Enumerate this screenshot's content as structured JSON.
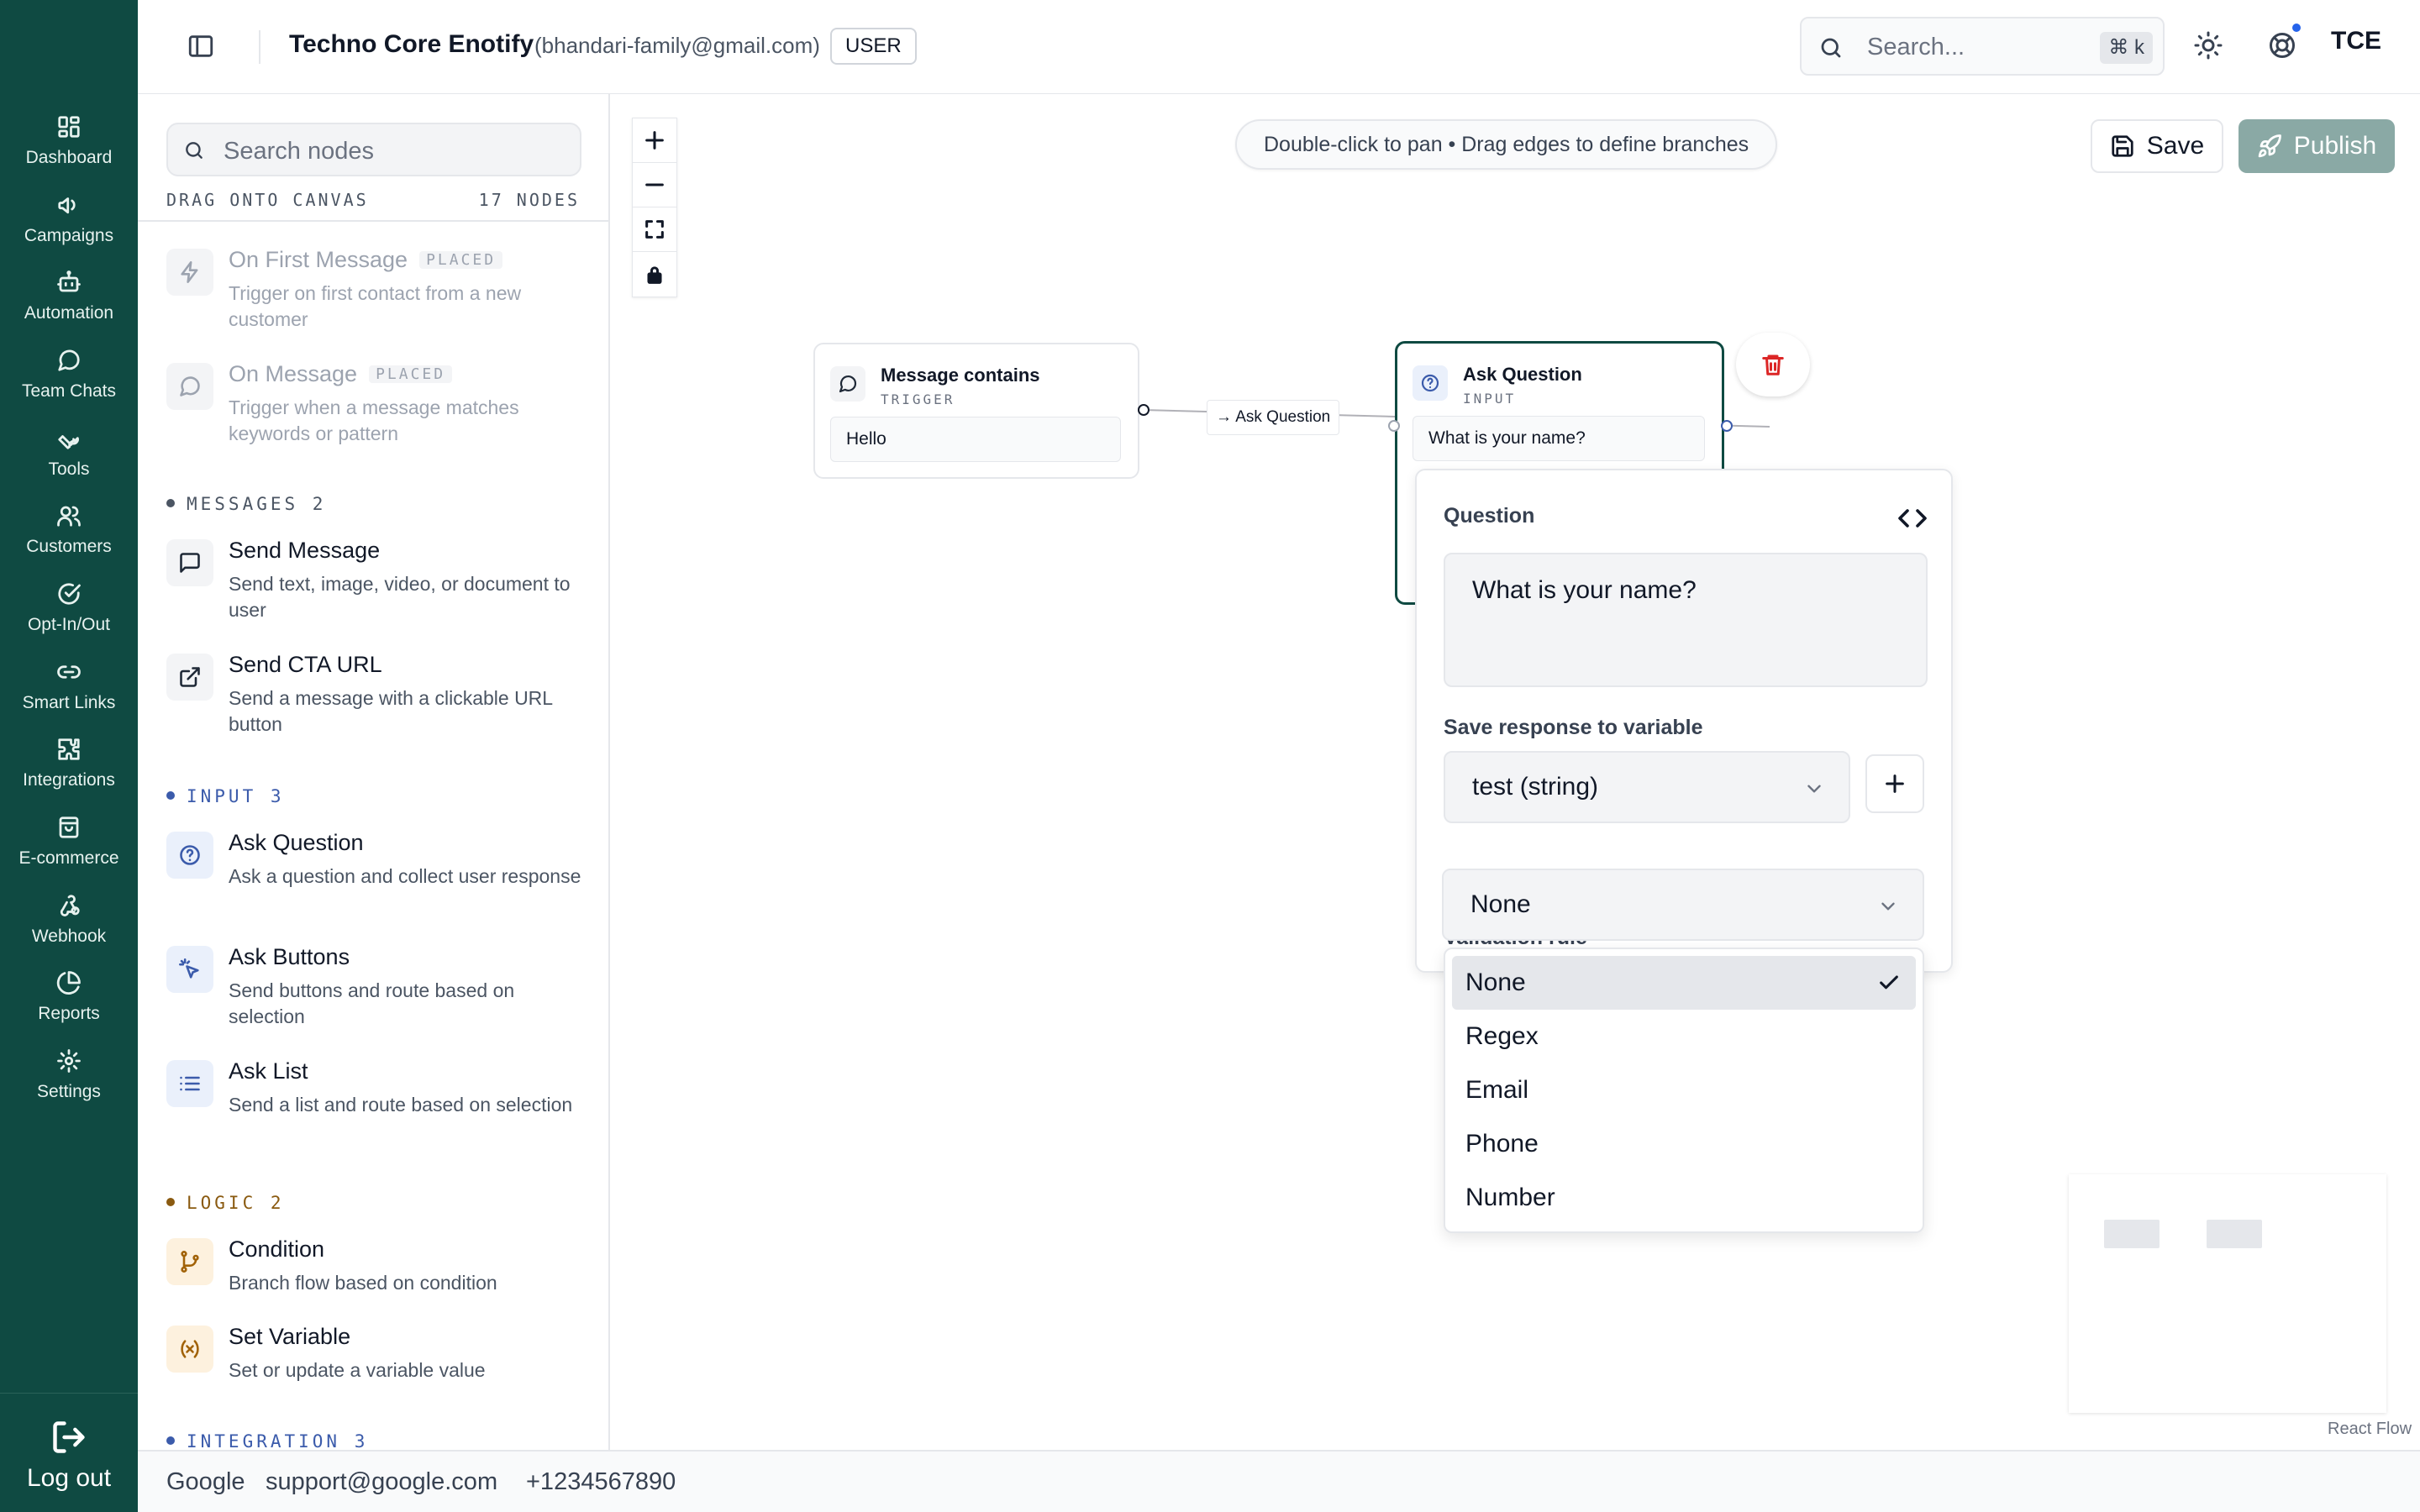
{
  "nav": {
    "items": [
      {
        "label": "Dashboard",
        "icon": "dashboard-icon"
      },
      {
        "label": "Campaigns",
        "icon": "megaphone-icon"
      },
      {
        "label": "Automation",
        "icon": "bot-icon"
      },
      {
        "label": "Team Chats",
        "icon": "chat-icon"
      },
      {
        "label": "Tools",
        "icon": "wrench-icon"
      },
      {
        "label": "Customers",
        "icon": "users-icon"
      },
      {
        "label": "Opt-In/Out",
        "icon": "check-circle-icon"
      },
      {
        "label": "Smart Links",
        "icon": "link-icon"
      },
      {
        "label": "Integrations",
        "icon": "puzzle-icon"
      },
      {
        "label": "E-commerce",
        "icon": "shopping-bag-icon"
      },
      {
        "label": "Webhook",
        "icon": "webhook-icon"
      },
      {
        "label": "Reports",
        "icon": "pie-chart-icon"
      },
      {
        "label": "Settings",
        "icon": "gear-icon"
      }
    ],
    "logout_label": "Log out"
  },
  "header": {
    "org_name": "Techno Core Enotify",
    "org_email": "(bhandari-family@gmail.com)",
    "role": "USER",
    "search_placeholder": "Search...",
    "search_shortcut": "⌘ k",
    "avatar_initials": "TCE",
    "notification_color": "#2563eb"
  },
  "palette": {
    "search_placeholder": "Search nodes",
    "drag_hint": "DRAG ONTO CANVAS",
    "node_count": "17 NODES",
    "placed_tag": "PLACED",
    "triggers": [
      {
        "title": "On First Message",
        "desc": "Trigger on first contact from a new customer",
        "placed": true
      },
      {
        "title": "On Message",
        "desc": "Trigger when a message matches keywords or pattern",
        "placed": true
      }
    ],
    "categories": {
      "messages": "MESSAGES 2",
      "input": "INPUT 3",
      "logic": "LOGIC 2",
      "integration": "INTEGRATION 3"
    },
    "messages": [
      {
        "title": "Send Message",
        "desc": "Send text, image, video, or document to user"
      },
      {
        "title": "Send CTA URL",
        "desc": "Send a message with a clickable URL button"
      }
    ],
    "input": [
      {
        "title": "Ask Question",
        "desc": "Ask a question and collect user response"
      },
      {
        "title": "Ask Buttons",
        "desc": "Send buttons and route based on selection"
      },
      {
        "title": "Ask List",
        "desc": "Send a list and route based on selection"
      }
    ],
    "logic": [
      {
        "title": "Condition",
        "desc": "Branch flow based on condition"
      },
      {
        "title": "Set Variable",
        "desc": "Set or update a variable value"
      }
    ]
  },
  "canvas": {
    "hint": "Double-click to pan • Drag edges to define branches",
    "save_label": "Save",
    "publish_label": "Publish",
    "attribution": "React Flow",
    "trigger_node": {
      "title": "Message contains",
      "type": "TRIGGER",
      "body": "Hello"
    },
    "edge_label": "→ Ask Question",
    "question_node": {
      "title": "Ask Question",
      "type": "INPUT",
      "body": "What is your name?"
    }
  },
  "editor": {
    "question_label": "Question",
    "question_value": "What is your name?",
    "variable_label": "Save response to variable",
    "variable_value": "test (string)",
    "rule_label": "Validation rule",
    "rule_value": "None",
    "rule_options": [
      "None",
      "Regex",
      "Email",
      "Phone",
      "Number"
    ],
    "rule_selected": "None"
  },
  "footer": {
    "company": "Google",
    "email": "support@google.com",
    "phone": "+1234567890"
  },
  "colors": {
    "nav_bg": "#0f4a42",
    "accent_teal": "#0f4a42",
    "publish_bg": "#8aa9a5",
    "messages_dot": "#6b7280",
    "input_dot": "#3b5bab",
    "logic_dot": "#8a5a10",
    "integration_dot": "#3b5bab",
    "delete_red": "#dc2626"
  }
}
